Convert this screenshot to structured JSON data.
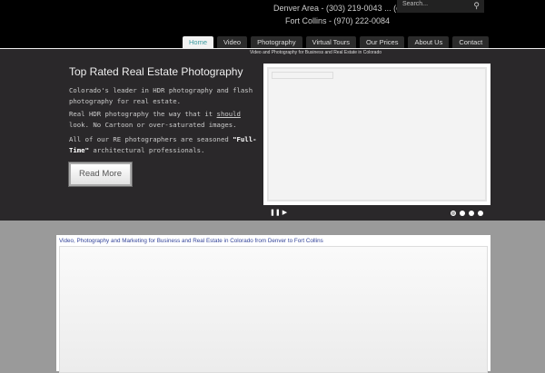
{
  "header": {
    "phone_denver": "Denver Area - (303) 219-0043 ... (or)",
    "phone_fc": "Fort Collins - (970) 222-0084",
    "search_placeholder": "Search..."
  },
  "nav": [
    "Home",
    "Video",
    "Photography",
    "Virtual Tours",
    "Our Prices",
    "About Us",
    "Contact"
  ],
  "hero": {
    "tagline": "Video and Photography for Business and Real Estate in Colorado",
    "title": "Top Rated Real Estate Photography",
    "p1": "Colorado's leader in HDR photography and flash photography for real estate.",
    "p2a": "Real HDR photography the way that it ",
    "p2u": "should",
    "p2b": " look. No Cartoon or over-saturated images.",
    "p3a": "All of our RE photographers are seasoned ",
    "p3b": "\"Full-Time\"",
    "p3c": " architectural professionals.",
    "button": "Read More",
    "pause": "❚❚",
    "play": "▶"
  },
  "content": {
    "caption": "Video, Photography and Marketing for Business and Real Estate in Colorado from Denver to Fort Collins"
  }
}
